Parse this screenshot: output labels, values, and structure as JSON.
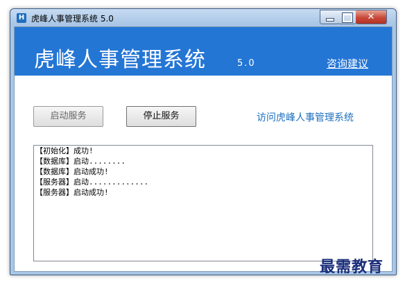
{
  "window": {
    "title": "虎峰人事管理系统 5.0",
    "icon_letter": "H",
    "controls": {
      "minimize": "",
      "maximize": "",
      "close": "✕"
    }
  },
  "header": {
    "title": "虎峰人事管理系统",
    "version": "5.0",
    "advice_link": "咨询建议"
  },
  "actions": {
    "start_service": "启动服务",
    "stop_service": "停止服务",
    "visit_link": "访问虎峰人事管理系统"
  },
  "log": {
    "lines": [
      "【初始化】成功!",
      "【数据库】启动........",
      "【数据库】启动成功!",
      "【服务器】启动.............",
      "【服务器】启动成功!"
    ]
  },
  "watermark": "最需教育",
  "colors": {
    "banner": "#2476d5",
    "link": "#1e6fc0"
  }
}
